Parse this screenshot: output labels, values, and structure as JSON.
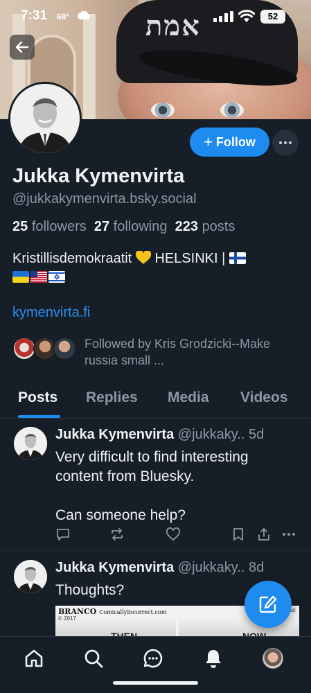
{
  "status_bar": {
    "time": "7:31",
    "temperature": "68°",
    "battery": "52"
  },
  "profile": {
    "display_name": "Jukka Kymenvirta",
    "handle": "@jukkakymenvirta.bsky.social",
    "followers_count": "25",
    "followers_label": "followers",
    "following_count": "27",
    "following_label": "following",
    "posts_count": "223",
    "posts_label": "posts",
    "bio_line1": "Kristillisdemokraatit",
    "bio_line1_after": "HELSINKI |",
    "website": "kymenvirta.fi",
    "followed_by": "Followed by Kris Grodzicki--Make russia small ..."
  },
  "actions": {
    "follow_label": "Follow",
    "follow_icon": "+"
  },
  "tabs": [
    {
      "label": "Posts",
      "active": true
    },
    {
      "label": "Replies",
      "active": false
    },
    {
      "label": "Media",
      "active": false
    },
    {
      "label": "Videos",
      "active": false
    }
  ],
  "posts": [
    {
      "author": "Jukka Kymenvirta",
      "handle": "@jukkaky..",
      "age": "5d",
      "text_line1": "Very difficult to find interesting content from Bluesky.",
      "text_line2": "Can someone help?"
    },
    {
      "author": "Jukka Kymenvirta",
      "handle": "@jukkaky..",
      "age": "8d",
      "text_line1": "Thoughts?"
    }
  ],
  "comic": {
    "brand": "BRANCO",
    "site": "ComicallyIncorrect.com",
    "copyright": "© 2017",
    "email": "Email:",
    "word1": "THEN",
    "word2": "NOW"
  },
  "colors": {
    "accent": "#1e8bf0",
    "background": "#161e27",
    "muted_text": "#8b98a5"
  },
  "icons": {
    "back": "arrow-left-icon",
    "more": "ellipsis-icon",
    "compose": "compose-icon",
    "nav": [
      "home-icon",
      "search-icon",
      "chat-icon",
      "bell-icon",
      "profile-avatar"
    ]
  }
}
